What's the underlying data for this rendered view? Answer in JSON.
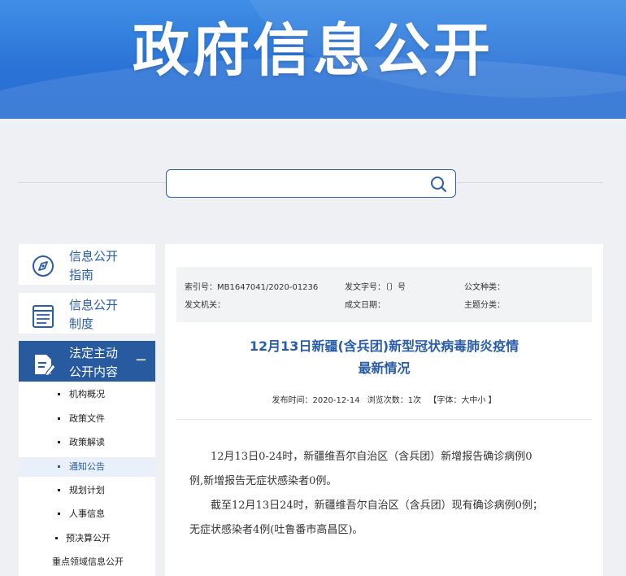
{
  "banner": {
    "title": "政府信息公开"
  },
  "search": {
    "placeholder": "",
    "value": ""
  },
  "sidebar": {
    "cards": [
      {
        "label_line1": "信息公开",
        "label_line2": "指南",
        "icon": "compass-icon"
      },
      {
        "label_line1": "信息公开",
        "label_line2": "制度",
        "icon": "document-list-icon"
      },
      {
        "label_line1": "法定主动",
        "label_line2": "公开内容",
        "icon": "edit-document-icon",
        "toggle": "−"
      }
    ],
    "sub_items": [
      "机构概况",
      "政策文件",
      "政策解读",
      "通知公告",
      "规划计划",
      "人事信息",
      "预决算公开",
      "重点领域信息公开"
    ],
    "active_sub": "通知公告"
  },
  "meta": {
    "index_no": "索引号：MB1647041/2020-01236",
    "doc_no": "发文字号：〔〕号",
    "category": "公文种类：",
    "issuer": "发文机关：",
    "date_made": "成文日期：",
    "topic": "主题分类："
  },
  "article": {
    "title_line1": "12月13日新疆(含兵团)新型冠状病毒肺炎疫情",
    "title_line2": "最新情况",
    "pub_date": "发布时间：2020-12-14",
    "views": "浏览次数：1次",
    "font_size": "【字体：大中小 】",
    "para1_line1": "12月13日0-24时，新疆维吾尔自治区（含兵团）新增报告确诊病例0",
    "para1_line2": "例,新增报告无症状感染者0例。",
    "para2_line1": "截至12月13日24时，新疆维吾尔自治区（含兵团）现有确诊病例0例；",
    "para2_line2": "无症状感染者4例(吐鲁番市高昌区)。"
  },
  "colors": {
    "banner": "#2a72d6",
    "accent": "#2a5da8",
    "active_nav": "#285a9f"
  }
}
